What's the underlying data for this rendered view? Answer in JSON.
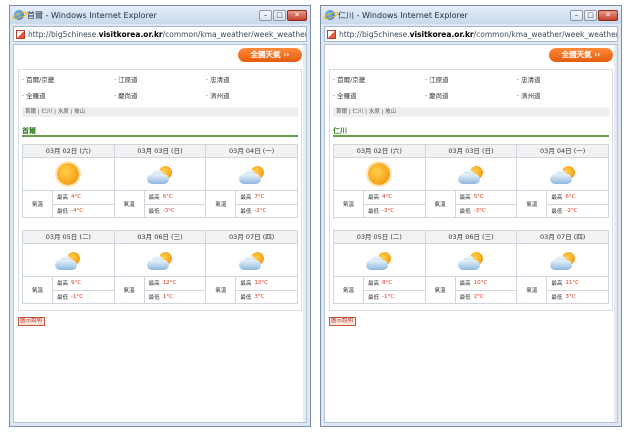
{
  "windows": [
    {
      "title": "首爾 - Windows Internet Explorer",
      "url_prefix": "http://big5chinese.",
      "url_host": "visitkorea.or.kr",
      "url_suffix": "/common/kma_weather/week_weather.jsp",
      "nation_button": "全國天氣 ››",
      "regions": [
        "首爾/京畿",
        "江原道",
        "忠清道",
        "全羅道",
        "慶尚道",
        "濟州道"
      ],
      "cities": "首爾 | 仁川 | 水原 | 坡山",
      "area_title": "首爾",
      "days": [
        {
          "date": "03月 02日 (六)",
          "icon": "sun-icon",
          "label": "氣溫",
          "max_label": "最高",
          "max": "4°C",
          "min_label": "最低",
          "min": "-4°C"
        },
        {
          "date": "03月 03日 (日)",
          "icon": "cloud-icon",
          "label": "氣溫",
          "max_label": "最高",
          "max": "6°C",
          "min_label": "最低",
          "min": "-3°C"
        },
        {
          "date": "03月 04日 (一)",
          "icon": "cloud-icon",
          "label": "氣溫",
          "max_label": "最高",
          "max": "7°C",
          "min_label": "最低",
          "min": "-2°C"
        },
        {
          "date": "03月 05日 (二)",
          "icon": "cloud-icon",
          "label": "氣溫",
          "max_label": "最高",
          "max": "9°C",
          "min_label": "最低",
          "min": "-1°C"
        },
        {
          "date": "03月 06日 (三)",
          "icon": "cloud-icon",
          "label": "氣溫",
          "max_label": "最高",
          "max": "12°C",
          "min_label": "最低",
          "min": "1°C"
        },
        {
          "date": "03月 07日 (四)",
          "icon": "cloud-icon",
          "label": "氣溫",
          "max_label": "最高",
          "max": "12°C",
          "min_label": "最低",
          "min": "3°C"
        }
      ],
      "legend": "圖示說明"
    },
    {
      "title": "仁川 - Windows Internet Explorer",
      "url_prefix": "http://big5chinese.",
      "url_host": "visitkorea.or.kr",
      "url_suffix": "/common/kma_weather/week_weather.jsp",
      "nation_button": "全國天氣 ››",
      "regions": [
        "首爾/京畿",
        "江原道",
        "忠清道",
        "全羅道",
        "慶尚道",
        "濟州道"
      ],
      "cities": "首爾 | 仁川 | 水原 | 坡山",
      "area_title": "仁川",
      "days": [
        {
          "date": "03月 02日 (六)",
          "icon": "sun-icon",
          "label": "氣溫",
          "max_label": "最高",
          "max": "4°C",
          "min_label": "最低",
          "min": "-3°C"
        },
        {
          "date": "03月 03日 (日)",
          "icon": "cloud-icon",
          "label": "氣溫",
          "max_label": "最高",
          "max": "5°C",
          "min_label": "最低",
          "min": "-3°C"
        },
        {
          "date": "03月 04日 (一)",
          "icon": "cloud-icon",
          "label": "氣溫",
          "max_label": "最高",
          "max": "6°C",
          "min_label": "最低",
          "min": "-2°C"
        },
        {
          "date": "03月 05日 (二)",
          "icon": "cloud-icon",
          "label": "氣溫",
          "max_label": "最高",
          "max": "8°C",
          "min_label": "最低",
          "min": "-1°C"
        },
        {
          "date": "03月 06日 (三)",
          "icon": "cloud-icon",
          "label": "氣溫",
          "max_label": "最高",
          "max": "10°C",
          "min_label": "最低",
          "min": "2°C"
        },
        {
          "date": "03月 07日 (四)",
          "icon": "cloud-icon",
          "label": "氣溫",
          "max_label": "最高",
          "max": "11°C",
          "min_label": "最低",
          "min": "3°C"
        }
      ],
      "legend": "圖示說明"
    }
  ]
}
